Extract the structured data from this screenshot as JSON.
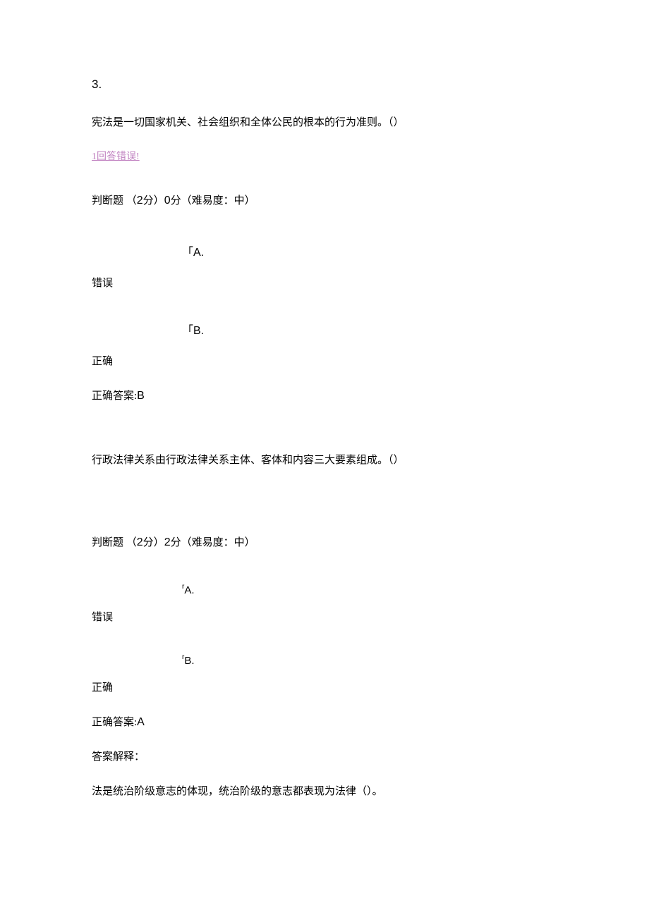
{
  "q1": {
    "number": "3.",
    "text": "宪法是一切国家机关、社会组织和全体公民的根本的行为准则。（）",
    "feedback": "1回答错误!",
    "meta_prefix": "判断题 （",
    "meta_points": "2",
    "meta_mid1": "分）",
    "meta_score": "0",
    "meta_mid2": "分（难易度：中）",
    "optA_marker": "「A.",
    "optA_text": "错误",
    "optB_marker": "「B.",
    "optB_text": "正确",
    "answer_label": "正确答案:",
    "answer_value": "B"
  },
  "q2": {
    "text": "行政法律关系由行政法律关系主体、客体和内容三大要素组成。（）",
    "meta_prefix": "判断题 （",
    "meta_points": "2",
    "meta_mid1": "分）",
    "meta_score": "2",
    "meta_mid2": "分（难易度：中）",
    "optA_sup": "r",
    "optA_marker": "A.",
    "optA_text": "错误",
    "optB_sup": "r",
    "optB_marker": "B.",
    "optB_text": "正确",
    "answer_label": "正确答案:",
    "answer_value": "A",
    "explain_label": "答案解释：",
    "next_text": "法是统治阶级意志的体现，统治阶级的意志都表现为法律（）。"
  }
}
